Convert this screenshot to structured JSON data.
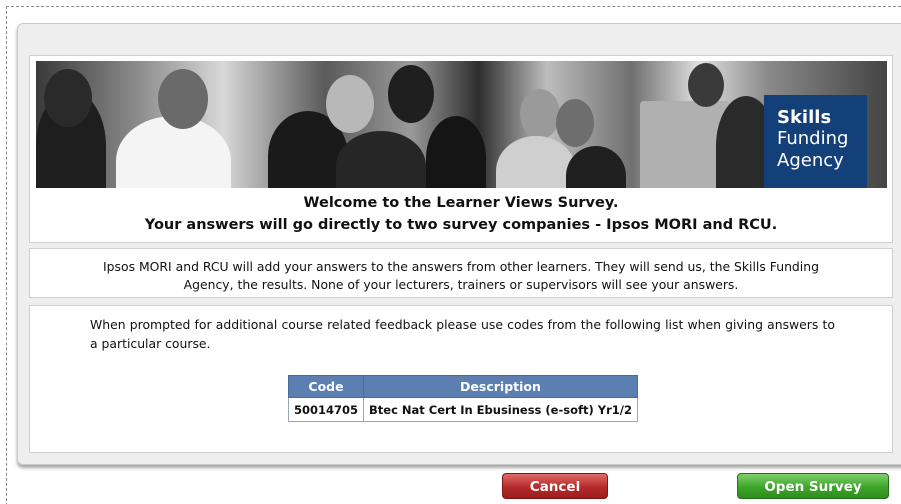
{
  "logo": {
    "line1": "Skills",
    "line2": "Funding",
    "line3": "Agency"
  },
  "welcome": {
    "line1": "Welcome to the Learner Views Survey.",
    "line2": "Your answers will go directly to two survey companies - Ipsos MORI and RCU."
  },
  "info": {
    "text": "Ipsos MORI and RCU will add your answers to the answers from other learners. They will send us, the Skills Funding Agency, the results. None of your lecturers, trainers or supervisors will see your answers."
  },
  "codes": {
    "prompt": "When prompted for additional course related feedback please use codes from the following list when giving answers to a particular course.",
    "headers": {
      "code": "Code",
      "description": "Description"
    },
    "rows": [
      {
        "code": "50014705",
        "description": "Btec Nat Cert In Ebusiness (e-soft) Yr1/2"
      }
    ]
  },
  "buttons": {
    "cancel": "Cancel",
    "open_survey": "Open Survey"
  },
  "colors": {
    "table_header": "#5b7fb0",
    "logo_background": "#14407a",
    "cancel_button": "#b52a2a",
    "open_button": "#3ea52a"
  }
}
